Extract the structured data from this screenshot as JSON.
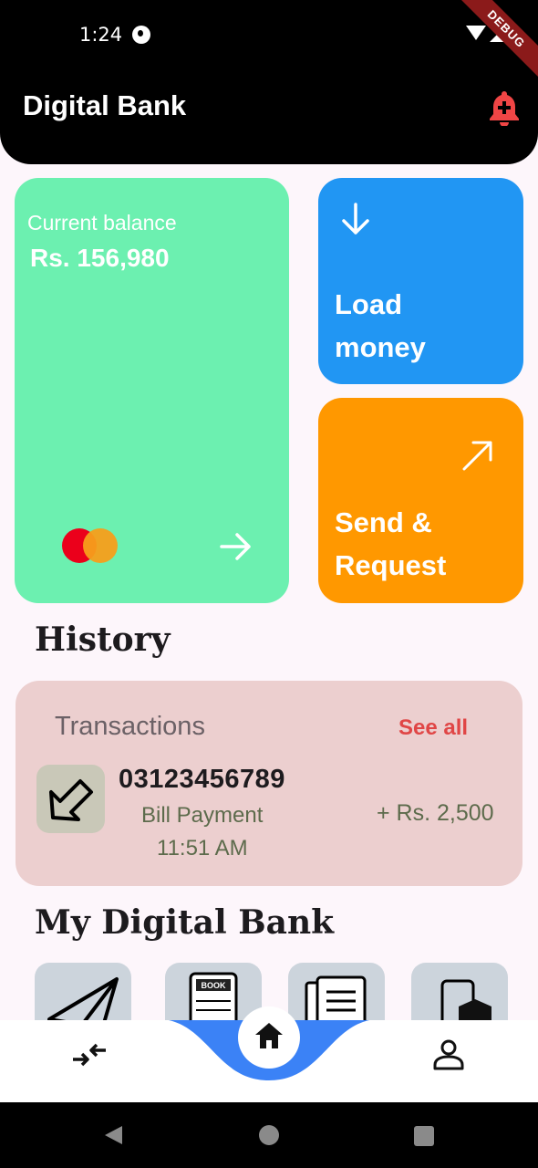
{
  "status_bar": {
    "time": "1:24",
    "debug_label": "DEBUG"
  },
  "header": {
    "title": "Digital Bank",
    "notification_icon": "bell-plus-icon"
  },
  "balance_card": {
    "label": "Current balance",
    "value": "Rs. 156,980",
    "color": "#6cf0b0"
  },
  "load_card": {
    "line1": "Load",
    "line2": "money",
    "color": "#2196f3"
  },
  "send_card": {
    "line1": "Send &",
    "line2": "Request",
    "color": "#ff9800"
  },
  "history": {
    "title": "History",
    "card_label": "Transactions",
    "see_all": "See all",
    "transaction": {
      "number": "03123456789",
      "type": "Bill Payment",
      "time": "11:51 AM",
      "amount": "+ Rs. 2,500"
    }
  },
  "my_bank": {
    "title": "My Digital Bank",
    "tiles": [
      "send-icon",
      "book-icon",
      "newspaper-icon",
      "mobile-package-icon"
    ]
  },
  "bottom_nav": {
    "items": [
      "transfer-icon",
      "home-icon",
      "profile-icon"
    ],
    "accent": "#3b82f6"
  }
}
